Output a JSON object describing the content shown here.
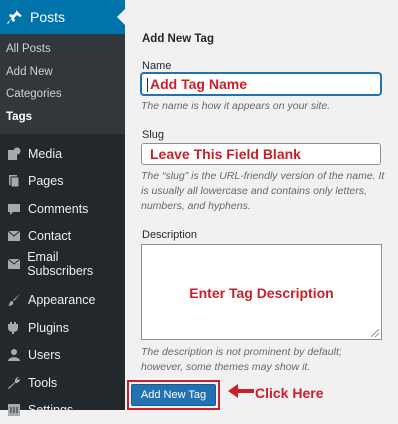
{
  "sidebar": {
    "active": {
      "label": "Posts",
      "icon": "pushpin-icon"
    },
    "submenu": [
      "All Posts",
      "Add New",
      "Categories",
      "Tags"
    ],
    "items": [
      {
        "label": "Media",
        "icon": "media-icon"
      },
      {
        "label": "Pages",
        "icon": "pages-icon"
      },
      {
        "label": "Comments",
        "icon": "comments-icon"
      },
      {
        "label": "Contact",
        "icon": "mail-icon"
      },
      {
        "label": "Email Subscribers",
        "icon": "mail-icon"
      }
    ],
    "items2": [
      {
        "label": "Appearance",
        "icon": "paintbrush-icon"
      },
      {
        "label": "Plugins",
        "icon": "plugin-icon"
      },
      {
        "label": "Users",
        "icon": "users-icon"
      },
      {
        "label": "Tools",
        "icon": "wrench-icon"
      },
      {
        "label": "Settings",
        "icon": "settings-icon"
      }
    ]
  },
  "form": {
    "heading": "Add New Tag",
    "name_label": "Name",
    "name_value": "Add Tag Name",
    "name_help": "The name is how it appears on your site.",
    "slug_label": "Slug",
    "slug_value": "Leave This Field Blank",
    "slug_help": "The “slug” is the URL-friendly version of the name. It is usually all lowercase and contains only letters, numbers, and hyphens.",
    "desc_label": "Description",
    "desc_value": "Enter Tag Description",
    "desc_help": "The description is not prominent by default; however, some themes may show it.",
    "submit_label": "Add New Tag",
    "annotation": "Click Here"
  },
  "colors": {
    "accent": "#0073aa",
    "annotation": "#c8202a",
    "sidebar_bg": "#23282d"
  }
}
